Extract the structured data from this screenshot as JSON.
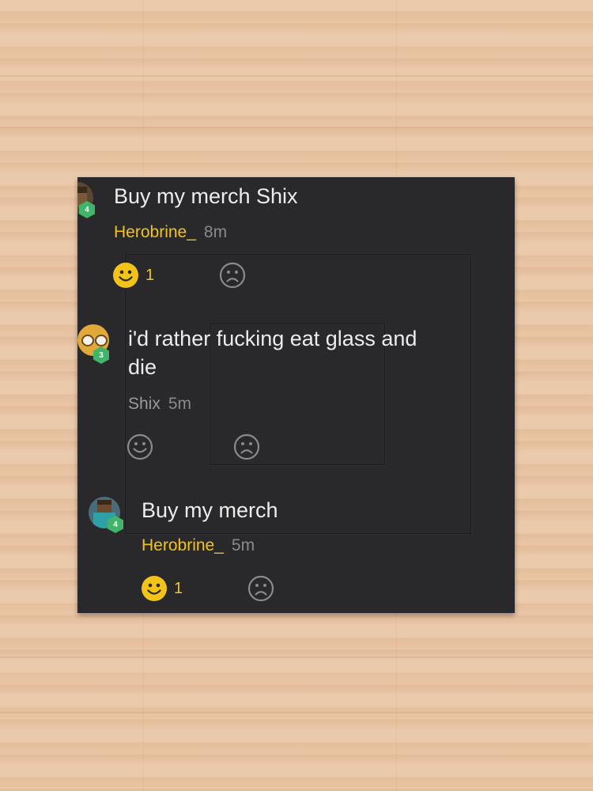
{
  "comments": [
    {
      "message": "Buy my merch Shix",
      "author": "Herobrine_",
      "time": "8m",
      "level": "4",
      "like_count": "1"
    },
    {
      "message_line1": "i'd rather fucking eat glass and",
      "message_line2": "die",
      "author": "Shix",
      "time": "5m",
      "level": "3"
    },
    {
      "message": "Buy my merch",
      "author": "Herobrine_",
      "time": "5m",
      "level": "4",
      "like_count": "1"
    }
  ],
  "colors": {
    "background_card": "#29292c",
    "author_highlight": "#f4c31a",
    "level_badge": "#41b36b",
    "reaction_active": "#f4c31a",
    "reaction_inactive": "#8a8a8e"
  },
  "icons": [
    "smiley-face-icon",
    "frown-face-icon",
    "user-avatar-icon"
  ]
}
